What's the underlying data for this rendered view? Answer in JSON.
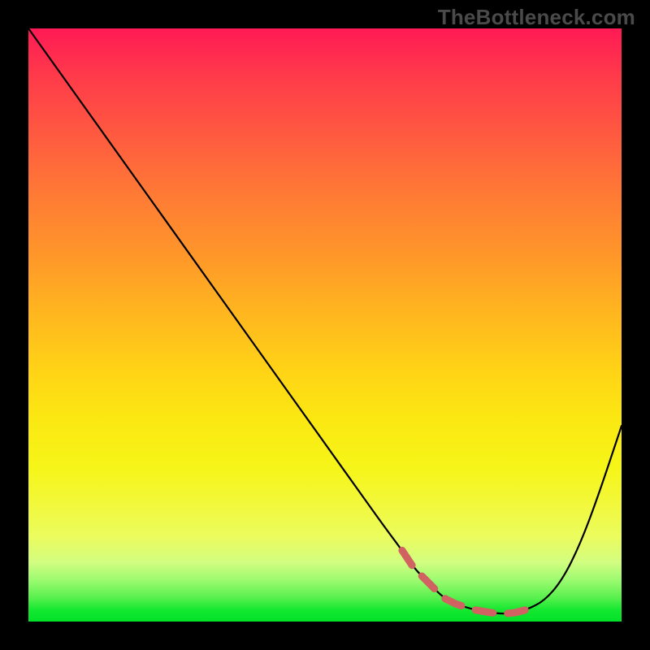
{
  "watermark": "TheBottleneck.com",
  "colors": {
    "frame_bg": "#000000",
    "gradient_top": "#ff1a55",
    "gradient_bottom": "#00e128",
    "curve_stroke": "#000000",
    "curve_fill": "none",
    "highlight_stroke": "#d06262"
  },
  "chart_data": {
    "type": "line",
    "title": "",
    "xlabel": "",
    "ylabel": "",
    "xlim": [
      0,
      100
    ],
    "ylim": [
      0,
      100
    ],
    "grid": false,
    "legend": false,
    "series": [
      {
        "name": "curve",
        "x": [
          0,
          5,
          10,
          15,
          20,
          25,
          30,
          35,
          40,
          45,
          50,
          55,
          60,
          63,
          65,
          68,
          70,
          72,
          75,
          78,
          80,
          82,
          84,
          87,
          90,
          93,
          96,
          100
        ],
        "y": [
          100,
          93,
          86,
          79,
          72,
          65,
          58,
          51,
          44,
          37,
          30,
          23,
          16,
          12,
          9,
          6,
          4,
          3,
          2,
          1.5,
          1.3,
          1.5,
          2,
          3.5,
          7,
          13,
          21,
          33
        ]
      }
    ],
    "highlight_range_x": [
      63,
      84
    ]
  }
}
